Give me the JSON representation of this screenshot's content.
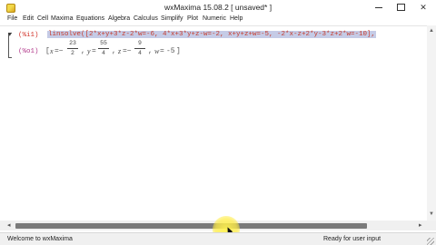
{
  "window": {
    "title": "wxMaxima 15.08.2 [ unsaved* ]"
  },
  "menu": [
    "File",
    "Edit",
    "Cell",
    "Maxima",
    "Equations",
    "Algebra",
    "Calculus",
    "Simplify",
    "Plot",
    "Numeric",
    "Help"
  ],
  "cell": {
    "input_label": "(%i1)",
    "input_text": "linsolve([2*x+y+3*z-2*w=-6, 4*x+3*y+z-w=-2, x+y+z+w=-5, -2*x-z+2*y-3*z+2*w=-10],",
    "output_label": "(%o1)",
    "output": {
      "open": "[",
      "x_var": "x",
      "x_num": "23",
      "x_den": "2",
      "y_var": "y",
      "y_num": "55",
      "y_den": "4",
      "z_var": "z",
      "z_num": "9",
      "z_den": "4",
      "w_var": "w",
      "w_val": "-5",
      "close": "]"
    }
  },
  "status": {
    "left": "Welcome to wxMaxima",
    "right": "Ready for user input"
  },
  "colors": {
    "input_label": "#d2342b",
    "input_highlight": "#c5cbe6",
    "output_label": "#b23b8c",
    "cursor_highlight": "#fff250"
  }
}
